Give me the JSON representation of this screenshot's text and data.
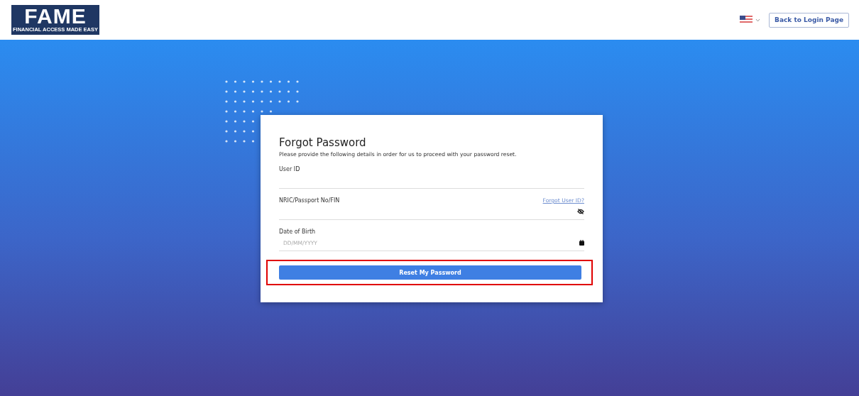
{
  "header": {
    "logo": {
      "title": "FAME",
      "tagline": "FINANCIAL ACCESS MADE EASY"
    },
    "back_button": "Back to Login Page"
  },
  "form": {
    "title": "Forgot Password",
    "description": "Please provide the following details in order for us to proceed with your password reset.",
    "fields": [
      {
        "kind": "text",
        "label": "User ID"
      },
      {
        "kind": "password",
        "label": "NRIC/Passport No/FIN",
        "link": "Forgot User ID?"
      },
      {
        "kind": "date",
        "label": "Date of Birth",
        "placeholder": "DD/MM/YYYY"
      }
    ],
    "submit": {
      "label": "Reset My Password",
      "highlighted": true
    }
  }
}
